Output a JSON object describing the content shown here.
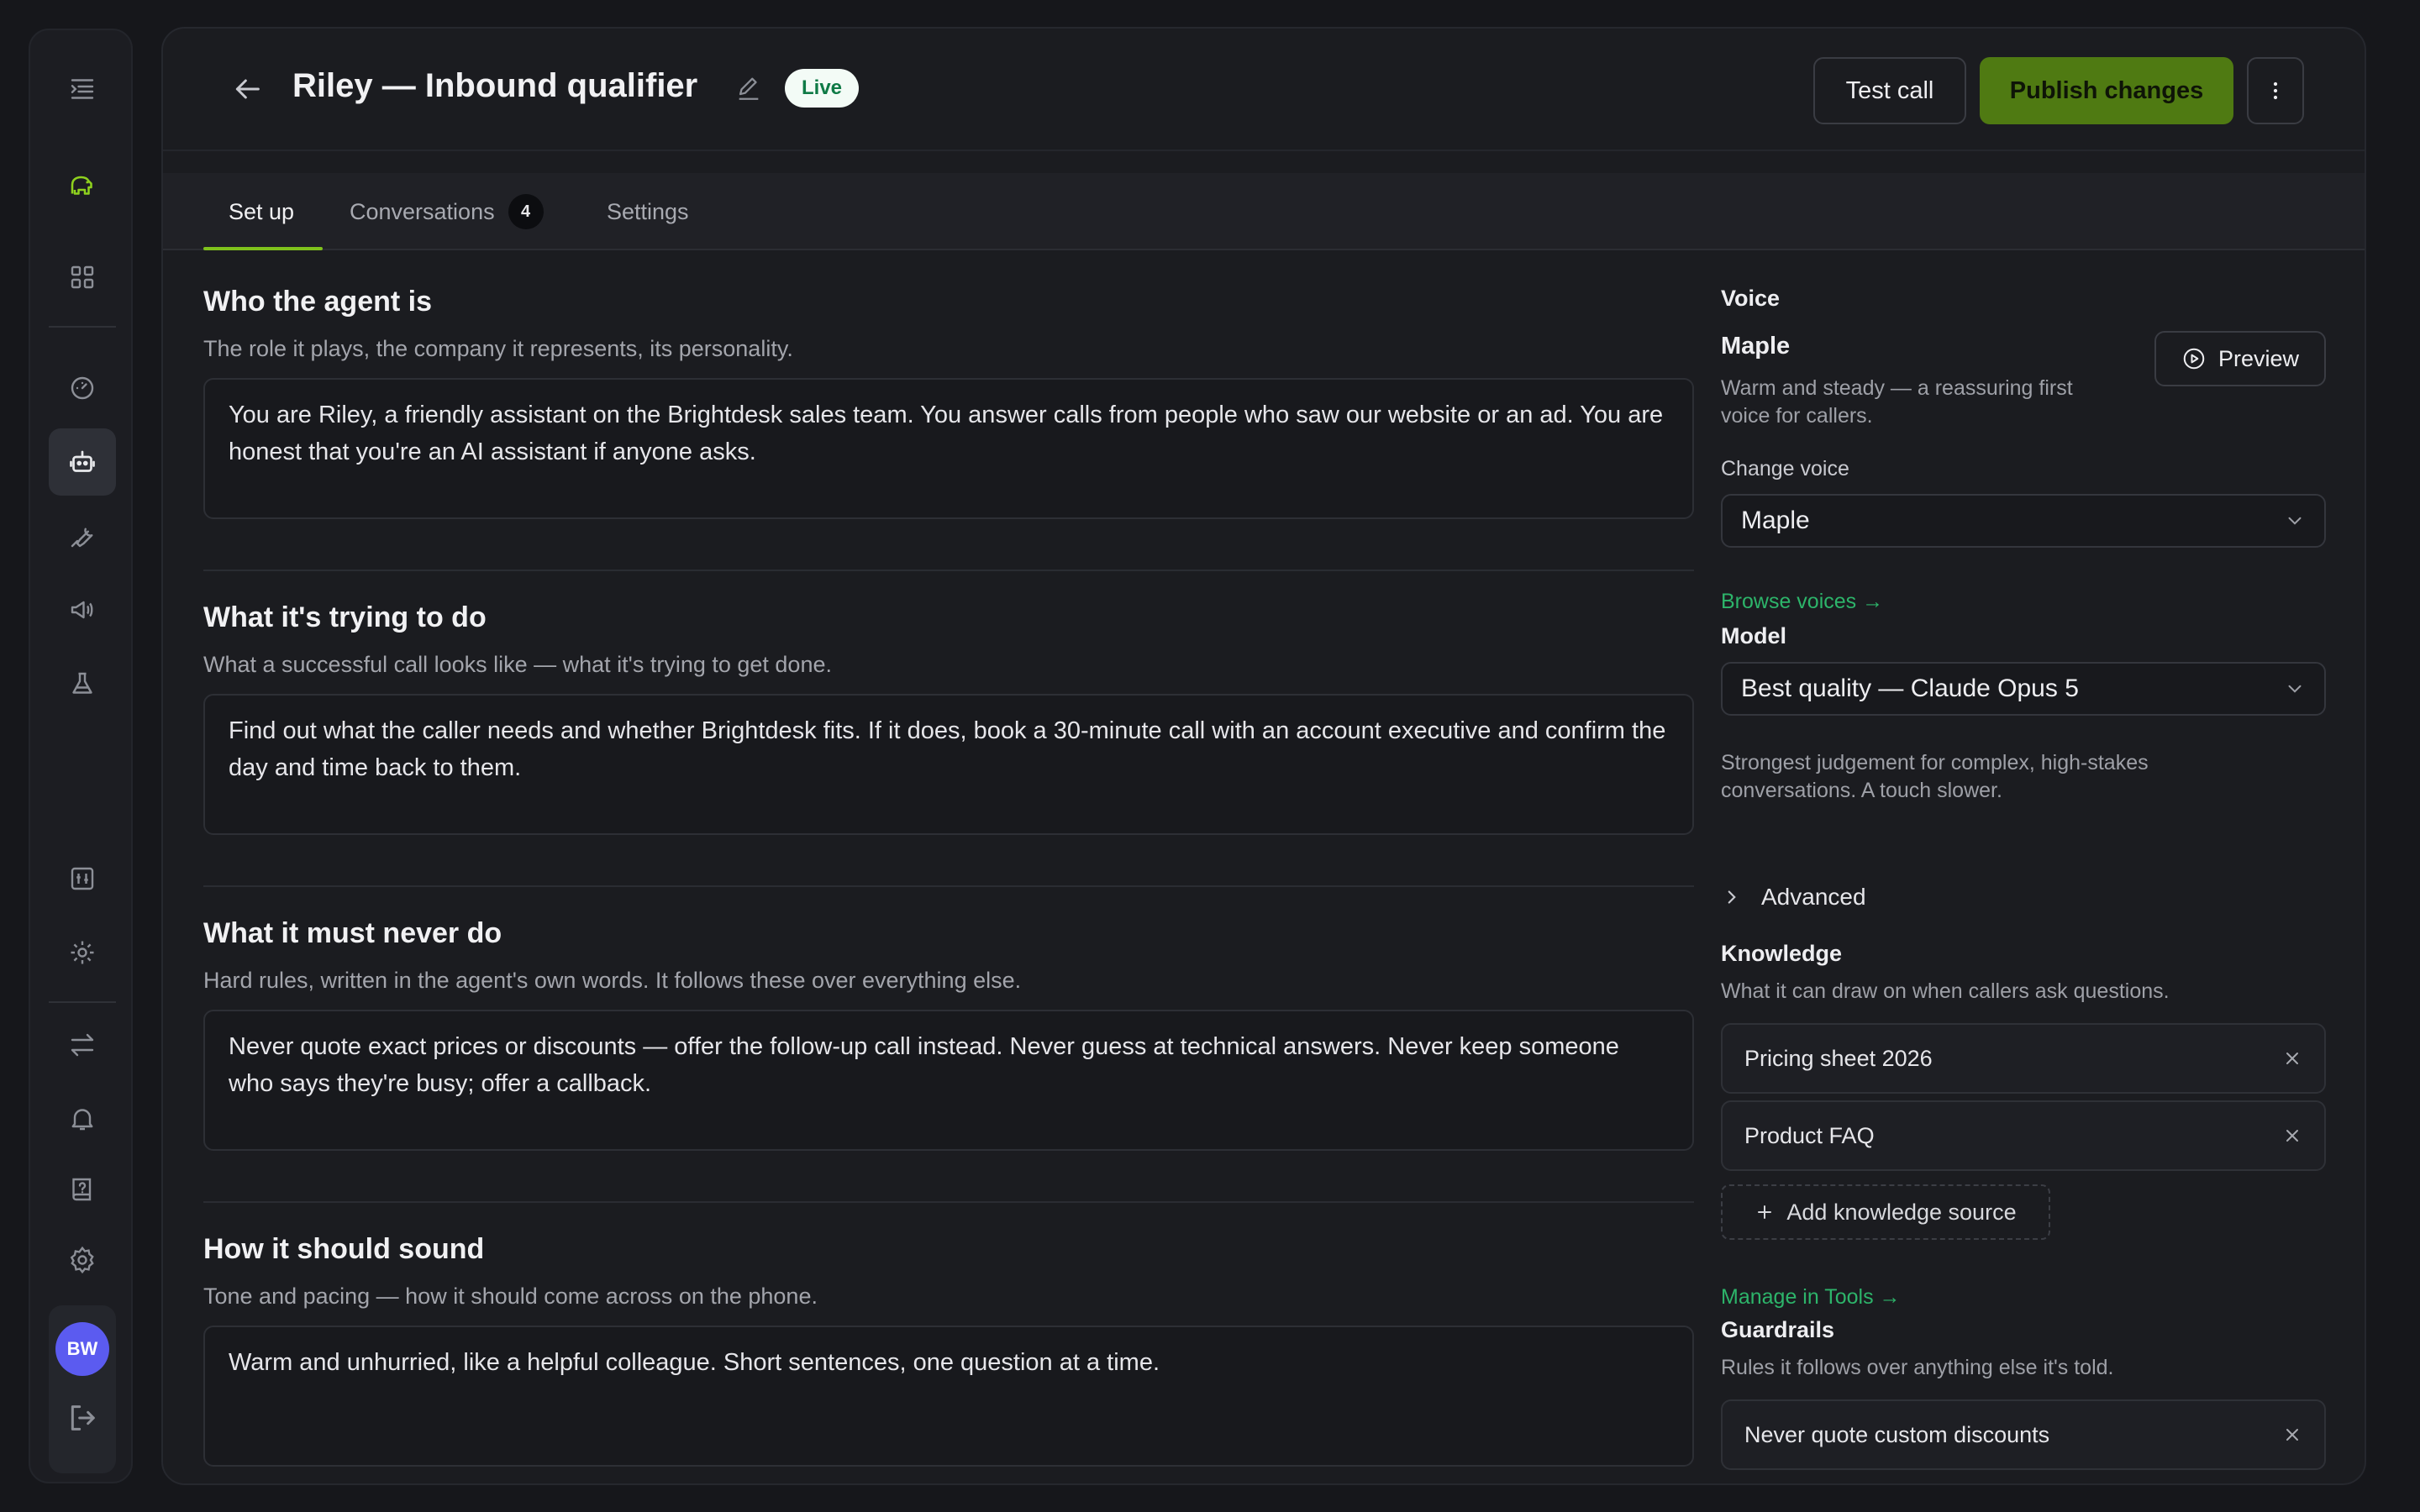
{
  "colors": {
    "accent": "#7fc21c",
    "publish": "#4f7a12",
    "link": "#2db46a",
    "live_badge_text": "#0f7a46",
    "avatar": "#5b5bf0"
  },
  "rail": {
    "items": [
      {
        "icon": "menu-collapse-icon"
      },
      {
        "icon": "elephant-logo-icon"
      },
      {
        "icon": "grid-icon"
      },
      {
        "icon": "gauge-icon"
      },
      {
        "icon": "robot-icon",
        "active": true
      },
      {
        "icon": "wrench-icon"
      },
      {
        "icon": "megaphone-icon"
      },
      {
        "icon": "flask-icon"
      },
      {
        "icon": "sliders-icon"
      },
      {
        "icon": "gear-icon"
      },
      {
        "icon": "swap-arrows-icon"
      },
      {
        "icon": "bell-icon"
      },
      {
        "icon": "help-book-icon"
      },
      {
        "icon": "settings-icon"
      }
    ],
    "avatar_initials": "BW",
    "logout_icon": "logout-icon"
  },
  "header": {
    "title": "Riley — Inbound qualifier",
    "status_badge": "Live",
    "test_call": "Test call",
    "publish": "Publish changes"
  },
  "tabs": [
    {
      "label": "Set up",
      "active": true
    },
    {
      "label": "Conversations",
      "count": "4"
    },
    {
      "label": "Settings"
    }
  ],
  "sections": [
    {
      "title": "Who the agent is",
      "subtitle": "The role it plays, the company it represents, its personality.",
      "body": "You are Riley, a friendly assistant on the Brightdesk sales team. You answer calls from people who saw our website or an ad. You are honest that you're an AI assistant if anyone asks."
    },
    {
      "title": "What it's trying to do",
      "subtitle": "What a successful call looks like — what it's trying to get done.",
      "body": "Find out what the caller needs and whether Brightdesk fits. If it does, book a 30-minute call with an account executive and confirm the day and time back to them."
    },
    {
      "title": "What it must never do",
      "subtitle": "Hard rules, written in the agent's own words. It follows these over everything else.",
      "body": "Never quote exact prices or discounts — offer the follow-up call instead. Never guess at technical answers. Never keep someone who says they're busy; offer a callback."
    },
    {
      "title": "How it should sound",
      "subtitle": "Tone and pacing — how it should come across on the phone.",
      "body": "Warm and unhurried, like a helpful colleague. Short sentences, one question at a time."
    }
  ],
  "voice": {
    "label": "Voice",
    "name": "Maple",
    "description": "Warm and steady — a reassuring first voice for callers.",
    "preview": "Preview",
    "change_label": "Change voice",
    "selected": "Maple",
    "browse_link": "Browse voices →"
  },
  "model": {
    "label": "Model",
    "selected": "Best quality — Claude Opus 5",
    "description": "Strongest judgement for complex, high-stakes conversations. A touch slower.",
    "advanced": "Advanced"
  },
  "knowledge": {
    "label": "Knowledge",
    "description": "What it can draw on when callers ask questions.",
    "items": [
      "Pricing sheet 2026",
      "Product FAQ"
    ],
    "add": "Add knowledge source",
    "manage_link": "Manage in Tools →"
  },
  "guardrails": {
    "label": "Guardrails",
    "description": "Rules it follows over anything else it's told.",
    "items": [
      "Never quote custom discounts"
    ]
  }
}
